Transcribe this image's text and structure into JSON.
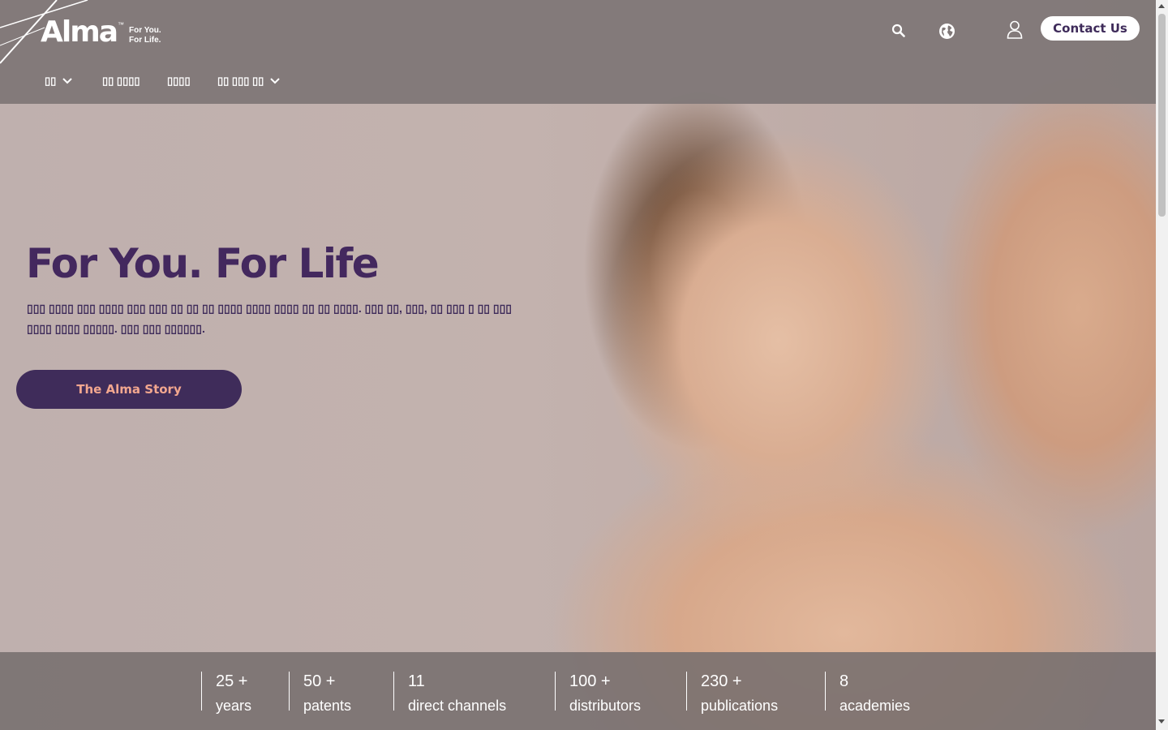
{
  "header": {
    "logo": {
      "word": "Alma",
      "tm": "™",
      "tagline_line1": "For You.",
      "tagline_line2": "For Life."
    },
    "icons": {
      "search": "search-icon",
      "language": "globe-icon",
      "account": "user-icon"
    },
    "contact_label": "Contact Us",
    "nav": [
      {
        "label": "▯▯",
        "dropdown": true
      },
      {
        "label": "▯▯ ▯▯▯▯",
        "dropdown": false
      },
      {
        "label": "▯▯▯▯",
        "dropdown": false
      },
      {
        "label": "▯▯ ▯▯▯ ▯▯",
        "dropdown": true
      }
    ]
  },
  "hero": {
    "title": "For You. For Life",
    "description": "▯▯▯ ▯▯▯▯ ▯▯▯ ▯▯▯▯ ▯▯▯ ▯▯▯ ▯▯ ▯▯ ▯▯ ▯▯▯▯ ▯▯▯▯ ▯▯▯▯ ▯▯ ▯▯ ▯▯▯▯. ▯▯▯ ▯▯, ▯▯▯, ▯▯ ▯▯▯ ▯ ▯▯ ▯▯▯ ▯▯▯▯ ▯▯▯▯ ▯▯▯▯▯. ▯▯▯ ▯▯▯ ▯▯▯▯▯▯.",
    "cta_label": "The Alma Story"
  },
  "stats": [
    {
      "number": "25 +",
      "label": "years"
    },
    {
      "number": "50 +",
      "label": "patents"
    },
    {
      "number": "11",
      "label": "direct channels"
    },
    {
      "number": "100 +",
      "label": "distributors"
    },
    {
      "number": "230 +",
      "label": "publications"
    },
    {
      "number": "8",
      "label": "academies"
    }
  ],
  "colors": {
    "brand_purple": "#43285e",
    "button_text_peach": "#f2a78f",
    "header_bg": "#807878",
    "stats_bg": "#766e6e"
  }
}
